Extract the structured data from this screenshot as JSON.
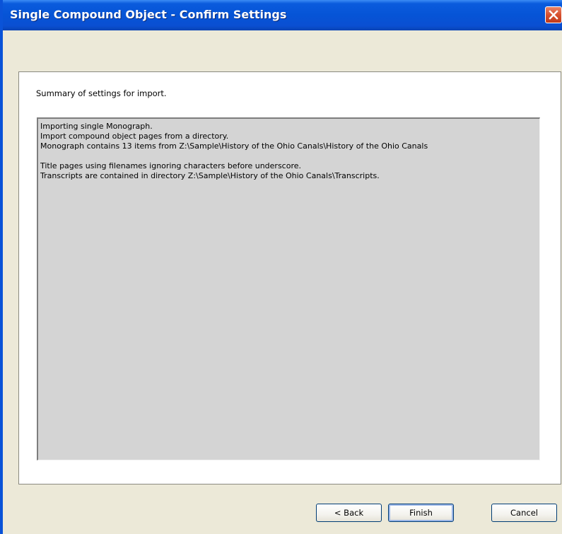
{
  "window": {
    "title": "Single Compound Object - Confirm Settings"
  },
  "panel": {
    "summary_label": "Summary of settings for import.",
    "summary_lines": [
      "Importing single Monograph.",
      "Import compound object pages from a directory.",
      "Monograph contains 13 items from Z:\\Sample\\History of the Ohio Canals\\History of the Ohio Canals",
      "",
      "Title pages using filenames ignoring characters before underscore.",
      "Transcripts are contained in directory Z:\\Sample\\History of the Ohio Canals\\Transcripts."
    ]
  },
  "buttons": {
    "back": "< Back",
    "finish": "Finish",
    "cancel": "Cancel"
  },
  "icons": {
    "close": "close-icon"
  },
  "colors": {
    "titlebar": "#0654D6",
    "window_bg": "#ECE9D8",
    "summary_bg": "#D4D4D4",
    "close_button": "#D8502E"
  }
}
